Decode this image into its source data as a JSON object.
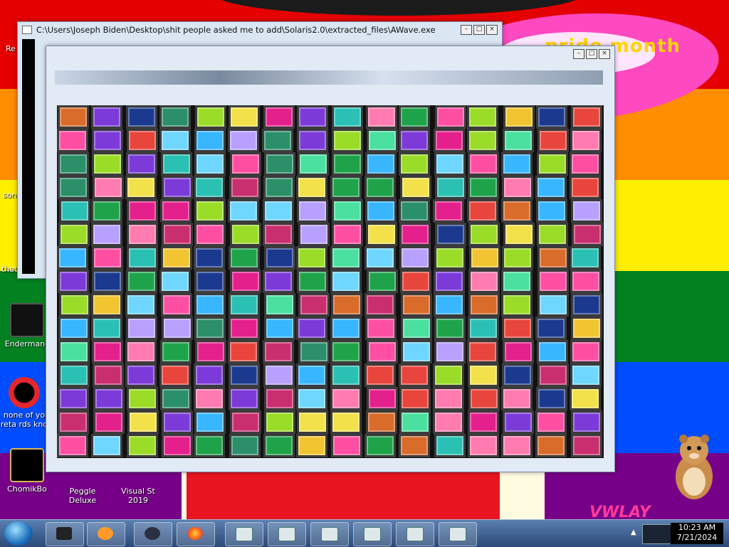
{
  "wallpaper": {
    "banner_text": "pride month",
    "corner_text": "VWLAY",
    "colors": [
      "#e50000",
      "#ff8d00",
      "#ffee00",
      "#028121",
      "#004cff",
      "#770088"
    ]
  },
  "desktop_icons": [
    {
      "label": "Endermanc",
      "icon": "app-icon"
    },
    {
      "label": "none of yo reta rds kno",
      "icon": "app-icon"
    },
    {
      "label": "ChomikBo",
      "icon": "app-icon"
    },
    {
      "label": "Peggle Deluxe",
      "icon": "game-icon"
    },
    {
      "label": "Visual St 2019",
      "icon": "app-icon"
    }
  ],
  "left_edge_labels": [
    "Re",
    "son",
    "that Se"
  ],
  "windows": {
    "back": {
      "title": "C:\\Users\\Joseph Biden\\Desktop\\shit people asked me to add\\Solaris2.0\\extracted_files\\AWave.exe",
      "controls": [
        "minimize",
        "maximize",
        "close"
      ]
    },
    "front": {
      "title": "",
      "controls": [
        "minimize",
        "maximize",
        "close"
      ]
    }
  },
  "taskbar": {
    "pinned": [
      "explorer-icon",
      "media-player-icon",
      "camera-icon",
      "firefox-icon",
      "window-icon",
      "window-icon",
      "window-icon",
      "window-icon",
      "window-icon",
      "window-icon"
    ],
    "clock": {
      "time": "10:23 AM",
      "date": "7/21/2024"
    }
  }
}
